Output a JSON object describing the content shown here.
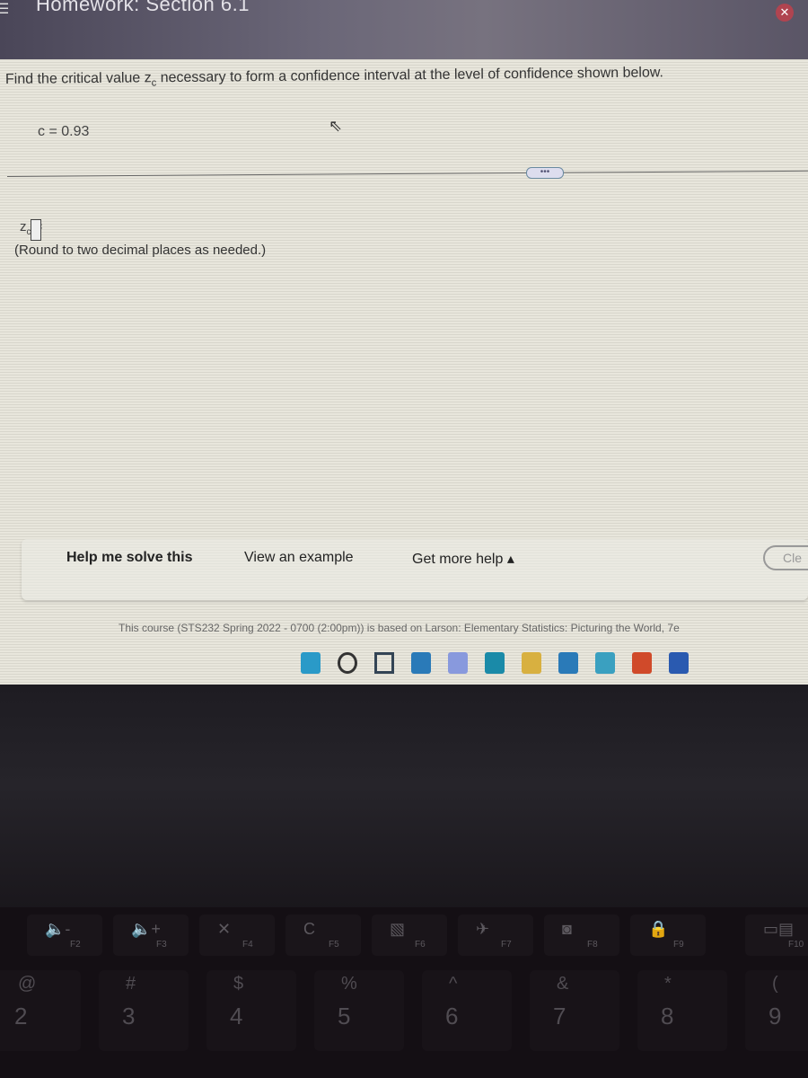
{
  "header": {
    "title": "Homework: Section 6.1",
    "close_icon": "close-icon",
    "menu_icon": "hamburger-icon"
  },
  "question": {
    "prompt_pre": "Find the critical value z",
    "prompt_sub": "c",
    "prompt_post": " necessary to form a confidence interval at the level of confidence shown below.",
    "given": "c = 0.93",
    "more_label": "•••",
    "answer_label": "z",
    "answer_sub": "c",
    "answer_eq": " =",
    "answer_value": "",
    "hint": "(Round to two decimal places as needed.)"
  },
  "help": {
    "help_me_solve": "Help me solve this",
    "view_example": "View an example",
    "get_more_help": "Get more help ▴",
    "clear": "Cle"
  },
  "footer": {
    "course_note": "This course (STS232 Spring 2022 - 0700 (2:00pm)) is based on Larson: Elementary Statistics: Picturing the World, 7e"
  },
  "taskbar": {
    "icons": [
      "windows-start-icon",
      "search-icon",
      "widgets-icon",
      "task-view-icon",
      "teams-chat-icon",
      "edge-icon",
      "file-explorer-icon",
      "store-icon",
      "mail-icon",
      "office-icon",
      "word-icon"
    ],
    "colors": [
      "#2a9ac8",
      "#333333",
      "#334455",
      "#2a7ab8",
      "#8899dd",
      "#1a8aa8",
      "#d8b040",
      "#2a7ab8",
      "#3aa0c0",
      "#d04a2a",
      "#2a5ab0"
    ]
  },
  "keyboard": {
    "fkeys": [
      {
        "glyph": "🔈-",
        "label": "F2"
      },
      {
        "glyph": "🔈+",
        "label": "F3"
      },
      {
        "glyph": "✕",
        "label": "F4"
      },
      {
        "glyph": "C",
        "label": "F5"
      },
      {
        "glyph": "▧",
        "label": "F6"
      },
      {
        "glyph": "✈",
        "label": "F7"
      },
      {
        "glyph": "◙",
        "label": "F8"
      },
      {
        "glyph": "🔒",
        "label": "F9"
      },
      {
        "glyph": "▭▤",
        "label": "F10"
      }
    ],
    "numkeys": [
      {
        "shift": "@",
        "num": "2"
      },
      {
        "shift": "#",
        "num": "3"
      },
      {
        "shift": "$",
        "num": "4"
      },
      {
        "shift": "%",
        "num": "5"
      },
      {
        "shift": "^",
        "num": "6"
      },
      {
        "shift": "&",
        "num": "7"
      },
      {
        "shift": "*",
        "num": "8"
      },
      {
        "shift": "(",
        "num": "9"
      }
    ]
  }
}
